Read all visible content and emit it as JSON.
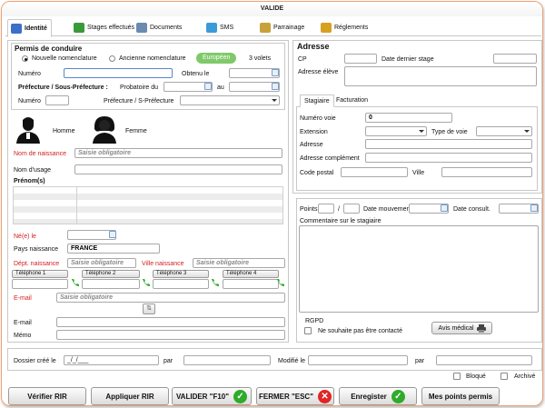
{
  "window": {
    "title": "VALIDE"
  },
  "tabs": [
    {
      "label": "Identité",
      "color": "#3b6fc9"
    },
    {
      "label": "Stages effectués",
      "color": "#3a9a3a"
    },
    {
      "label": "Documents",
      "color": "#6a8ab0"
    },
    {
      "label": "SMS",
      "color": "#3b9bd9"
    },
    {
      "label": "Parrainage",
      "color": "#c9a13b"
    },
    {
      "label": "Réglements",
      "color": "#d8a020"
    }
  ],
  "permis": {
    "title": "Permis de conduire",
    "radio_new": "Nouvelle nomenclature",
    "radio_old": "Ancienne nomenclature",
    "pill_label": "Européen",
    "volets_label": "3 volets",
    "numero_label": "Numéro",
    "obtenu_label": "Obtenu le",
    "prefecture_label": "Préfecture / Sous-Préfecture :",
    "probatoire_label": "Probatoire du",
    "au_label": "au",
    "numero2_label": "Numéro",
    "pref_sp_label": "Préfecture / S-Préfecture"
  },
  "identity": {
    "homme_label": "Homme",
    "femme_label": "Femme",
    "nom_naissance_label": "Nom de naissance",
    "placeholder": "Saisie obligatoire",
    "nom_usage_label": "Nom d'usage",
    "prenoms_label": "Prénom(s)",
    "ne_le_label": "Né(e) le",
    "pays_naissance_label": "Pays naissance",
    "pays_naissance_value": "FRANCE",
    "dept_naissance_label": "Dépt. naissance",
    "ville_naissance_label": "Ville naissance",
    "telephones": [
      "Téléphone 1",
      "Téléphone 2",
      "Téléphone 3",
      "Téléphone 4"
    ],
    "email_label": "E-mail",
    "email2_label": "E-mail",
    "memo_label": "Mémo"
  },
  "adresse": {
    "title": "Adresse",
    "cp_label": "CP",
    "dernier_stage_label": "Date dernier stage",
    "adresse_eleve_label": "Adresse élève",
    "subtabs": [
      "Stagiaire",
      "Facturation"
    ],
    "numero_voie_label": "Numéro voie",
    "numero_voie_value": "0",
    "extension_label": "Extension",
    "type_voie_label": "Type de voie",
    "adresse_label": "Adresse",
    "adresse_complement_label": "Adresse complément",
    "code_postal_label": "Code postal",
    "ville_label": "Ville"
  },
  "points": {
    "points_label": "Points",
    "slash": "/",
    "date_mouvement_label": "Date mouvement",
    "date_consult_label": "Date consult.",
    "commentaire_label": "Commentaire sur le stagiaire",
    "rgpd_label": "RGPD",
    "no_contact_label": "Ne souhaite pas être contacté",
    "avis_medical_label": "Avis médical"
  },
  "footer": {
    "dossier_cree_label": "Dossier créé le",
    "dossier_cree_value": "_/_/___",
    "par_label": "par",
    "modifie_label": "Modifié le",
    "par2_label": "par",
    "bloque_label": "Bloqué",
    "archive_label": "Archivé"
  },
  "buttons": {
    "verifier": "Vérifier RIR",
    "appliquer": "Appliquer RIR",
    "valider": "VALIDER \"F10\"",
    "fermer": "FERMER \"ESC\"",
    "enregistrer": "Enregister",
    "points": "Mes points permis"
  },
  "colors": {
    "required": "#d42020",
    "ok": "#2faa2a",
    "cancel": "#e02525",
    "accent": "#7fc96a"
  }
}
